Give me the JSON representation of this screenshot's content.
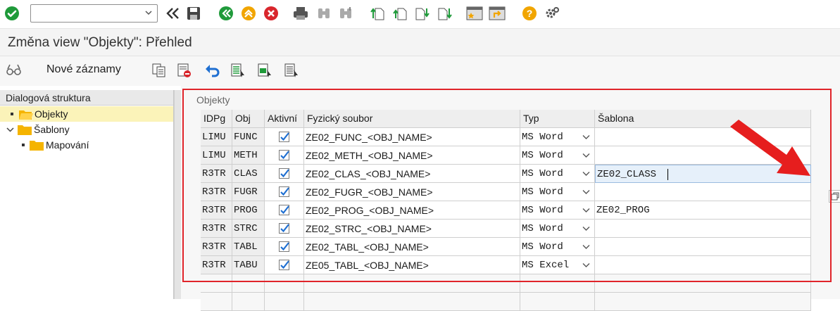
{
  "command_field": {
    "value": ""
  },
  "title": "Změna view \"Objekty\": Přehled",
  "app_toolbar": {
    "new_entries": "Nové záznamy"
  },
  "tree": {
    "header": "Dialogová struktura",
    "items": [
      {
        "label": "Objekty",
        "selected": true
      },
      {
        "label": "Šablony",
        "selected": false
      },
      {
        "label": "Mapování",
        "selected": false
      }
    ]
  },
  "table": {
    "group_title": "Objekty",
    "columns": [
      "IDPg",
      "Obj",
      "Aktivní",
      "Fyzický soubor",
      "Typ",
      "Šablona"
    ],
    "rows": [
      {
        "idpg": "LIMU",
        "obj": "FUNC",
        "active": true,
        "file": "ZE02_FUNC_<OBJ_NAME>",
        "type": "MS Word",
        "template": ""
      },
      {
        "idpg": "LIMU",
        "obj": "METH",
        "active": true,
        "file": "ZE02_METH_<OBJ_NAME>",
        "type": "MS Word",
        "template": ""
      },
      {
        "idpg": "R3TR",
        "obj": "CLAS",
        "active": true,
        "file": "ZE02_CLAS_<OBJ_NAME>",
        "type": "MS Word",
        "template": "ZE02_CLASS"
      },
      {
        "idpg": "R3TR",
        "obj": "FUGR",
        "active": true,
        "file": "ZE02_FUGR_<OBJ_NAME>",
        "type": "MS Word",
        "template": ""
      },
      {
        "idpg": "R3TR",
        "obj": "PROG",
        "active": true,
        "file": "ZE02_PROG_<OBJ_NAME>",
        "type": "MS Word",
        "template": "ZE02_PROG"
      },
      {
        "idpg": "R3TR",
        "obj": "STRC",
        "active": true,
        "file": "ZE02_STRC_<OBJ_NAME>",
        "type": "MS Word",
        "template": ""
      },
      {
        "idpg": "R3TR",
        "obj": "TABL",
        "active": true,
        "file": "ZE02_TABL_<OBJ_NAME>",
        "type": "MS Word",
        "template": ""
      },
      {
        "idpg": "R3TR",
        "obj": "TABU",
        "active": true,
        "file": "ZE05_TABL_<OBJ_NAME>",
        "type": "MS Excel",
        "template": ""
      }
    ]
  },
  "colors": {
    "accent_green": "#1f9a3a",
    "cancel_red": "#d9262c",
    "folder": "#f5b400",
    "highlight_frame": "#e0242a",
    "selected_node": "#fbf3b9"
  },
  "icons": [
    "check-icon",
    "chevron-down-icon",
    "back-double-icon",
    "save-icon",
    "back-icon",
    "exit-icon",
    "cancel-icon",
    "print-icon",
    "find-icon",
    "find-next-icon",
    "first-page-icon",
    "prev-page-icon",
    "next-page-icon",
    "last-page-icon",
    "new-session-icon",
    "shortcut-icon",
    "help-icon",
    "settings-icon",
    "glasses-icon",
    "copy-icon",
    "delete-icon",
    "undo-icon",
    "select-all-icon",
    "select-block-icon",
    "deselect-all-icon",
    "folder-icon",
    "value-help-icon",
    "arrow-annotation"
  ]
}
